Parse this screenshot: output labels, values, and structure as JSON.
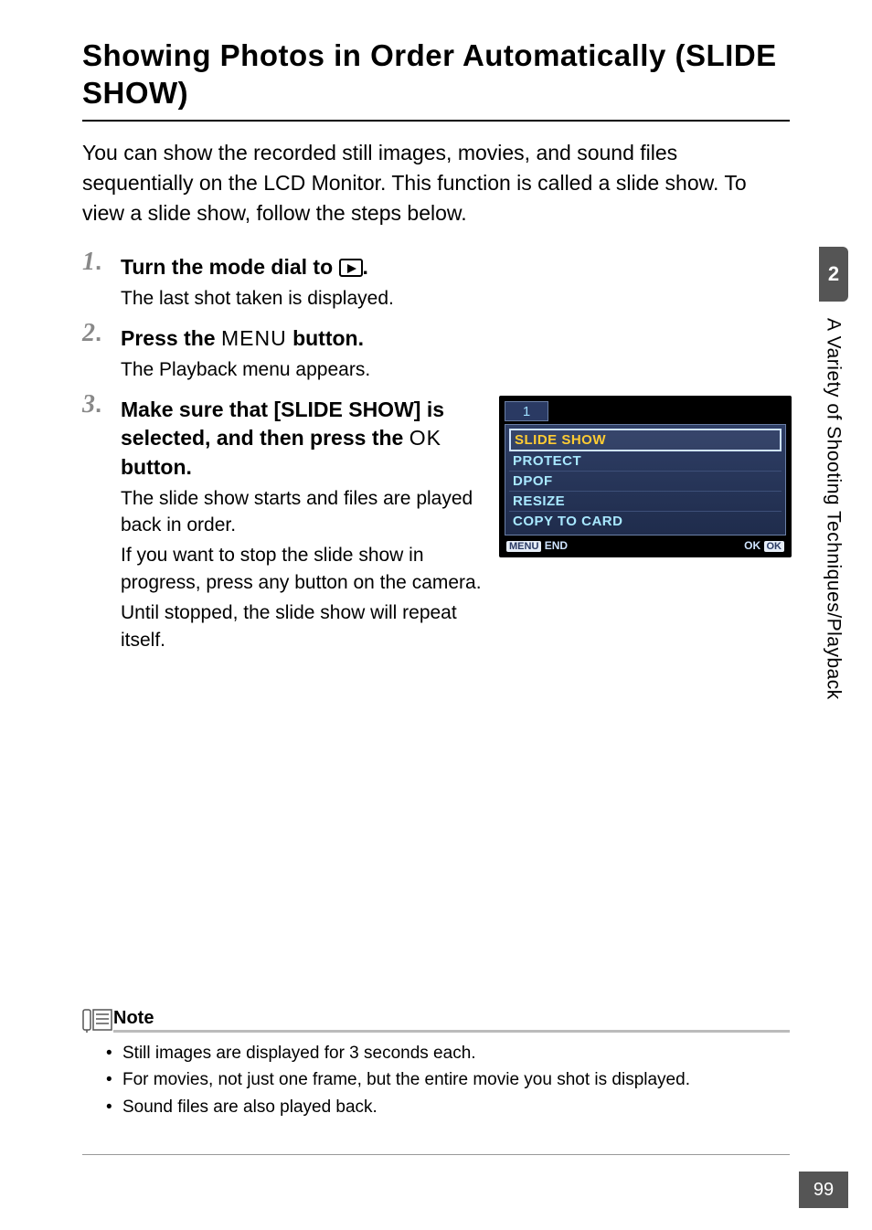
{
  "heading": "Showing Photos in Order Automatically (SLIDE SHOW)",
  "intro": "You can show the recorded still images, movies, and sound files sequentially on the LCD Monitor. This function is called a slide show. To view a slide show, follow the steps below.",
  "steps": {
    "s1": {
      "num": "1",
      "title_a": "Turn the mode dial to ",
      "title_b": ".",
      "body": "The last shot taken is displayed."
    },
    "s2": {
      "num": "2",
      "title_a": "Press the ",
      "menu_label": "MENU",
      "title_b": " button.",
      "body": "The Playback menu appears."
    },
    "s3": {
      "num": "3",
      "title_a": "Make sure that [SLIDE SHOW] is selected, and then press the ",
      "ok_label": "OK",
      "title_b": " button.",
      "body_p1": "The slide show starts and files are played back in order.",
      "body_p2": "If you want to stop the slide show in progress, press any button on the camera.",
      "body_p3": "Until stopped, the slide show will repeat itself."
    }
  },
  "lcd": {
    "tab": "1",
    "rows": {
      "r0": "SLIDE SHOW",
      "r1": "PROTECT",
      "r2": "DPOF",
      "r3": "RESIZE",
      "r4": "COPY TO CARD"
    },
    "footer_left_btn": "MENU",
    "footer_left_txt": "END",
    "footer_right_btn": "OK",
    "footer_right_txt": "OK"
  },
  "sidebar": {
    "section_num": "2",
    "label": "A Variety of Shooting Techniques/Playback"
  },
  "note": {
    "title": "Note",
    "items": {
      "n0": "Still images are displayed for 3 seconds each.",
      "n1": "For movies, not just one frame, but the entire movie you shot is displayed.",
      "n2": "Sound files are also played back."
    }
  },
  "page_number": "99"
}
